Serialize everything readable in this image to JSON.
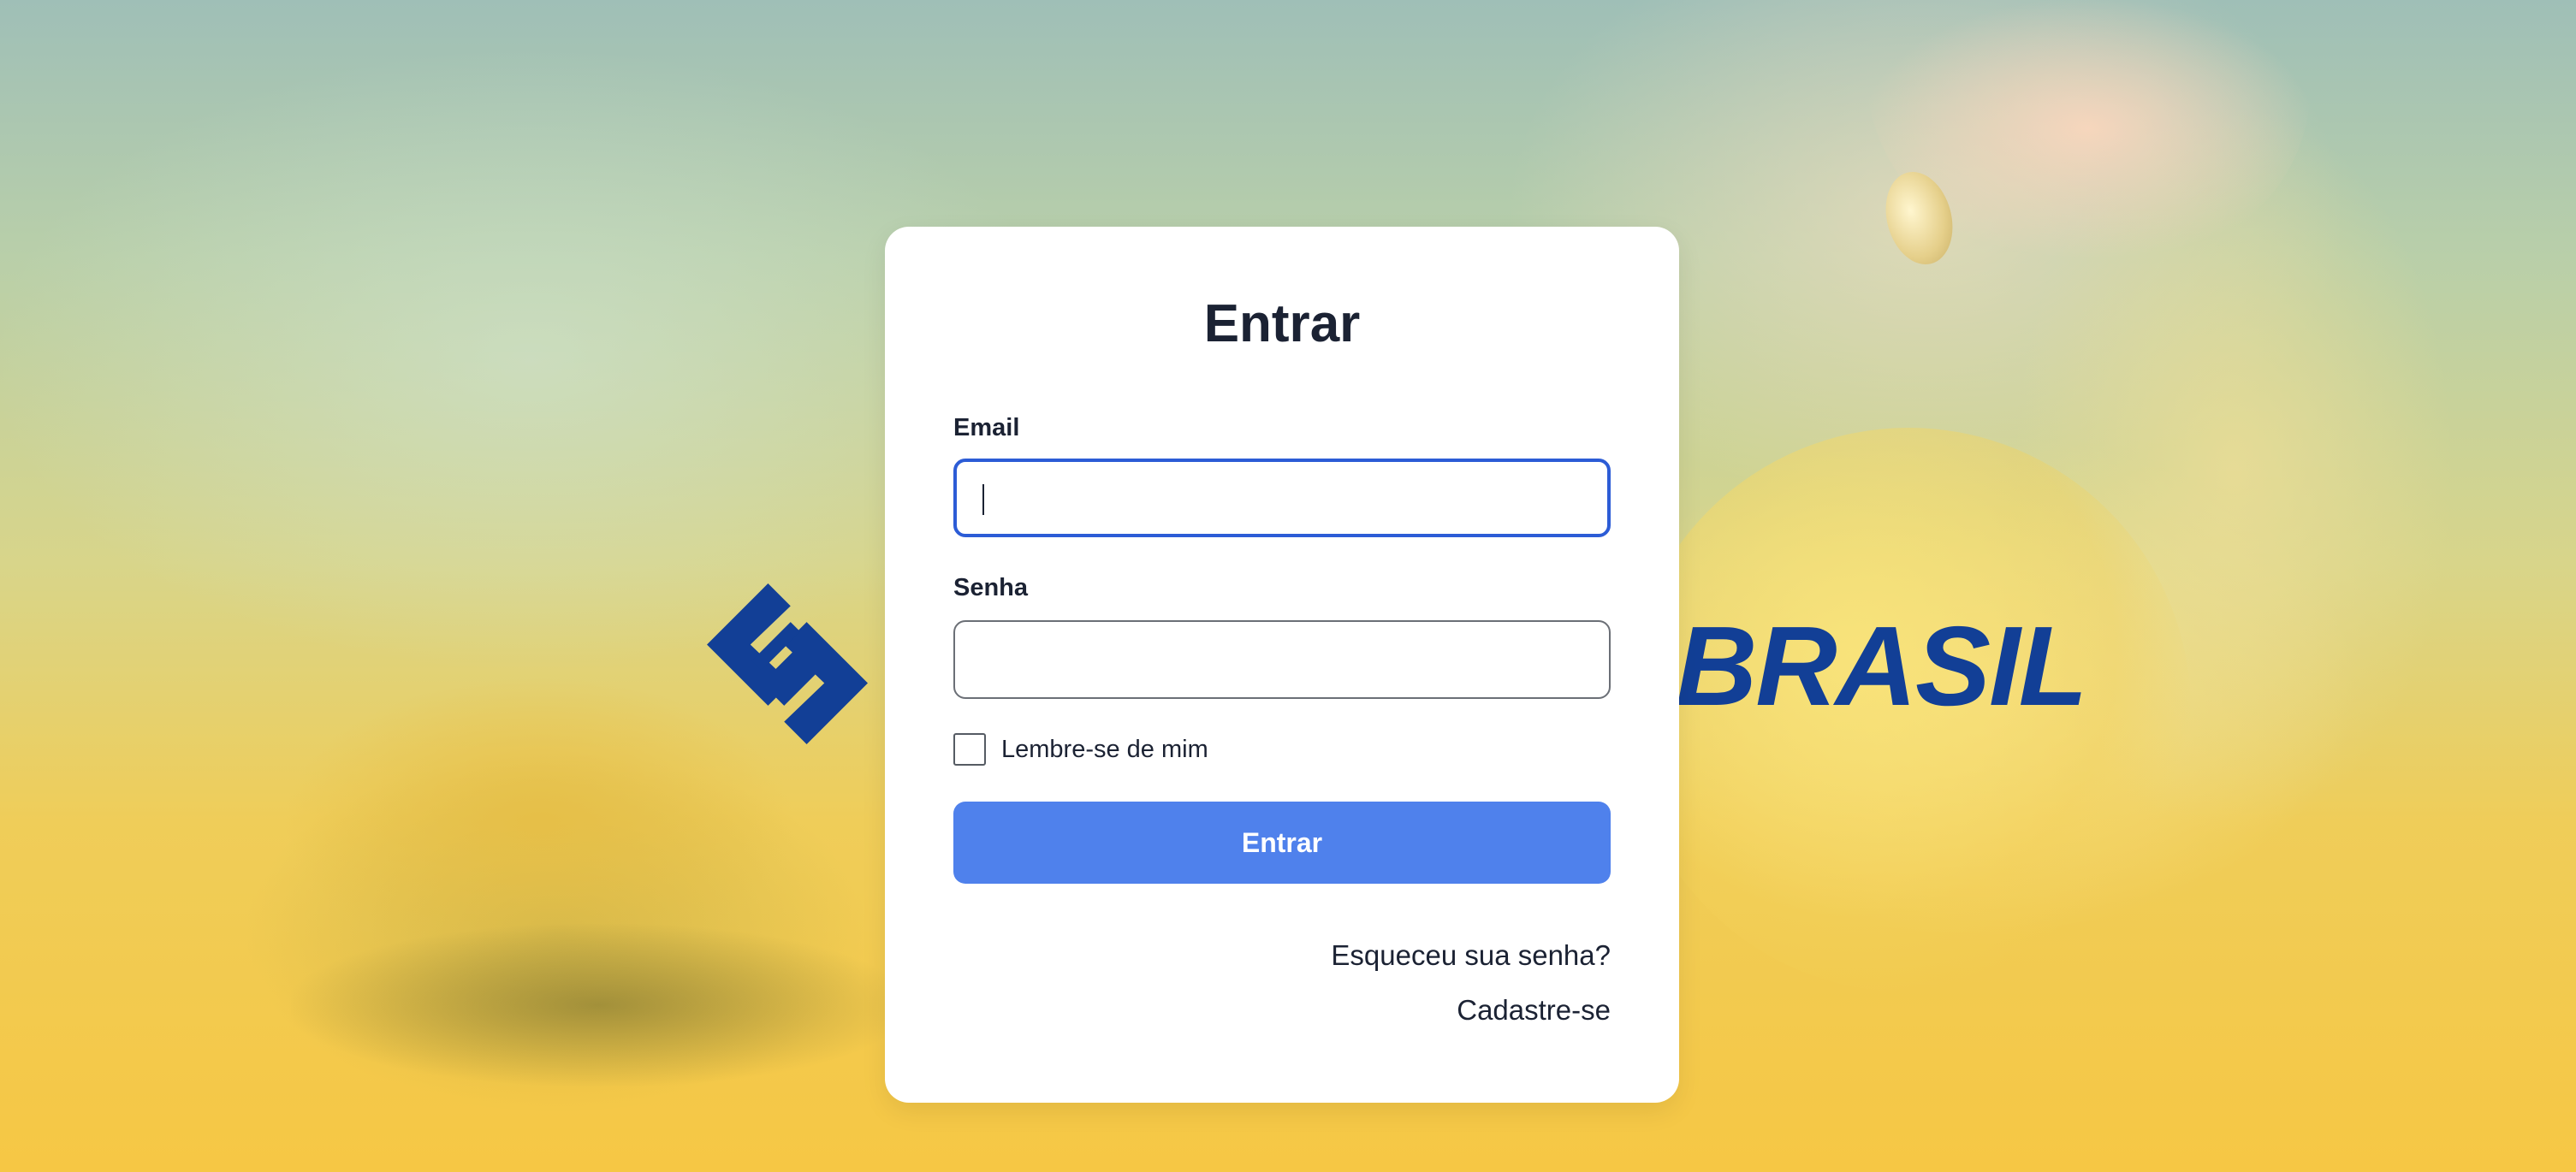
{
  "brand": {
    "logo_text": "BRASIL",
    "logo_color": "#123f96"
  },
  "background": {
    "top_color": "#9fbfb7",
    "bottom_color": "#f6c744"
  },
  "login_card": {
    "title": "Entrar",
    "email": {
      "label": "Email",
      "value": "",
      "placeholder": ""
    },
    "password": {
      "label": "Senha",
      "value": "",
      "placeholder": ""
    },
    "remember_me": {
      "label": "Lembre-se de mim",
      "checked": false
    },
    "submit_label": "Entrar",
    "forgot_password_link": "Esqueceu sua senha?",
    "signup_link": "Cadastre-se",
    "accent_color": "#4f81ec",
    "focus_color": "#2c5cd6"
  }
}
